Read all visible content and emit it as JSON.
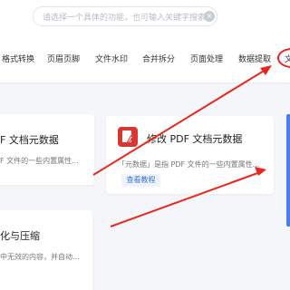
{
  "search": {
    "placeholder": "请选择一个具体的功能，也可输入关键字搜索！",
    "clear_icon": "×"
  },
  "tabs": [
    "格式转换",
    "页眉页脚",
    "文件水印",
    "合并拆分",
    "页面处理",
    "数据提取",
    "文"
  ],
  "cards": {
    "left_top": {
      "title": "F 文档元数据",
      "desc": "F 文件的一些内置属性..."
    },
    "center": {
      "title": "修改 PDF 文档元数据",
      "desc": "「元数据」是指 PDF 文件的一些内置属性...",
      "button": "查看教程"
    },
    "left_bottom": {
      "title": "化与压缩",
      "desc": "中无效的内容，并自动..."
    }
  },
  "colors": {
    "annotation": "#e8281e",
    "accent": "#3b6fe0",
    "pdf_red": "#d9362f"
  }
}
